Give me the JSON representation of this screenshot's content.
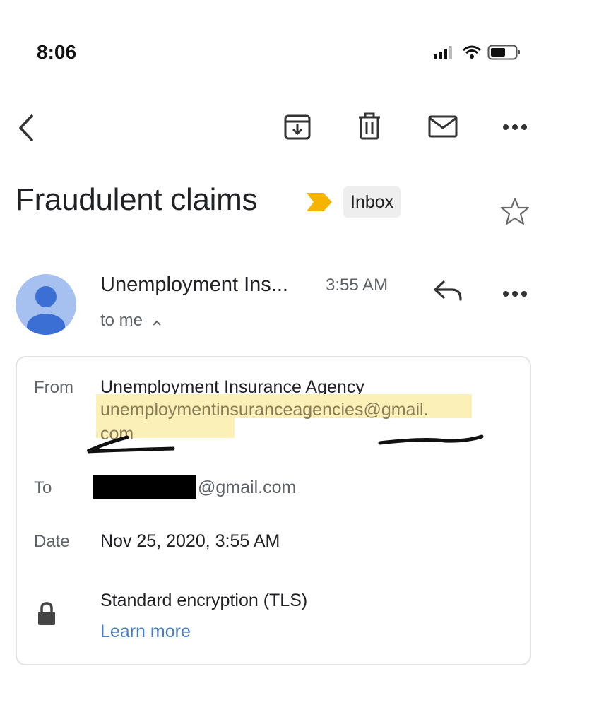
{
  "status_bar": {
    "time": "8:06"
  },
  "toolbar": {
    "icons": [
      "back-icon",
      "archive-icon",
      "delete-icon",
      "mark-unread-icon",
      "more-options-icon"
    ]
  },
  "message": {
    "subject": "Fraudulent claims",
    "label": "Inbox",
    "sender_short": "Unemployment Ins...",
    "time": "3:55 AM",
    "recipient_summary": "to me",
    "details": {
      "from_key": "From",
      "from_name": "Unemployment Insurance Agency",
      "from_email_line1": "unemploymentinsuranceagencies@gmail.",
      "from_email_line2": "com",
      "to_key": "To",
      "to_value": "@gmail.com",
      "date_key": "Date",
      "date_value": "Nov 25, 2020, 3:55 AM",
      "security_text": "Standard encryption (TLS)",
      "learn_more": "Learn more"
    }
  },
  "colors": {
    "important_marker": "#f4b400",
    "highlight": "#fbf1b8",
    "link": "#4a7fc1",
    "avatar_bg": "#a6c0ef",
    "avatar_fg": "#3b6fd4"
  }
}
